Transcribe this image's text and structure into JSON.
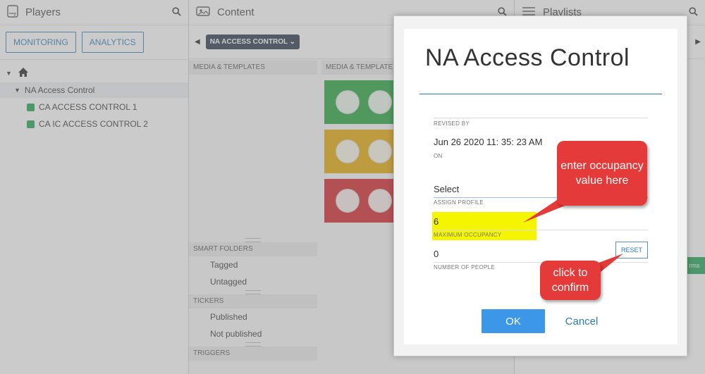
{
  "players": {
    "title": "Players",
    "monitoring_label": "MONITORING",
    "analytics_label": "ANALYTICS",
    "tree_root": "NA Access Control",
    "tree_children": [
      "CA ACCESS CONTROL 1",
      "CA IC ACCESS CONTROL 2"
    ]
  },
  "content": {
    "title": "Content",
    "tab_label": "NA ACCESS CONTROL",
    "col_left": "MEDIA & TEMPLATES",
    "col_right": "MEDIA & TEMPLATES",
    "smart_folders": "SMART FOLDERS",
    "smart_items": [
      "Tagged",
      "Untagged"
    ],
    "tickers": "TICKERS",
    "ticker_items": [
      "Published",
      "Not published"
    ],
    "triggers": "TRIGGERS"
  },
  "playlists": {
    "title": "Playlists",
    "pill_text": "rms"
  },
  "modal": {
    "title": "NA Access Control",
    "revised_by_label": "REVISED BY",
    "revised_on_value": "Jun 26 2020 11: 35: 23 AM",
    "on_label": "ON",
    "profile_value": "Select",
    "profile_label": "ASSIGN PROFILE",
    "max_occupancy_value": "6",
    "max_occupancy_label": "MAXIMUM OCCUPANCY",
    "people_value": "0",
    "people_label": "NUMBER OF PEOPLE",
    "reset_label": "RESET",
    "ok_label": "OK",
    "cancel_label": "Cancel"
  },
  "annotations": {
    "callout1": "enter occupancy value here",
    "callout2": "click to confirm",
    "highlight_color": "#f5f500",
    "callout_color": "#e43a3a"
  },
  "colors": {
    "accent": "#2b7bb9",
    "ok_button": "#3d97e8",
    "status_green": "#1aa34a",
    "thumb_colors": [
      "#22a33a",
      "#e6a800",
      "#d42027"
    ]
  }
}
